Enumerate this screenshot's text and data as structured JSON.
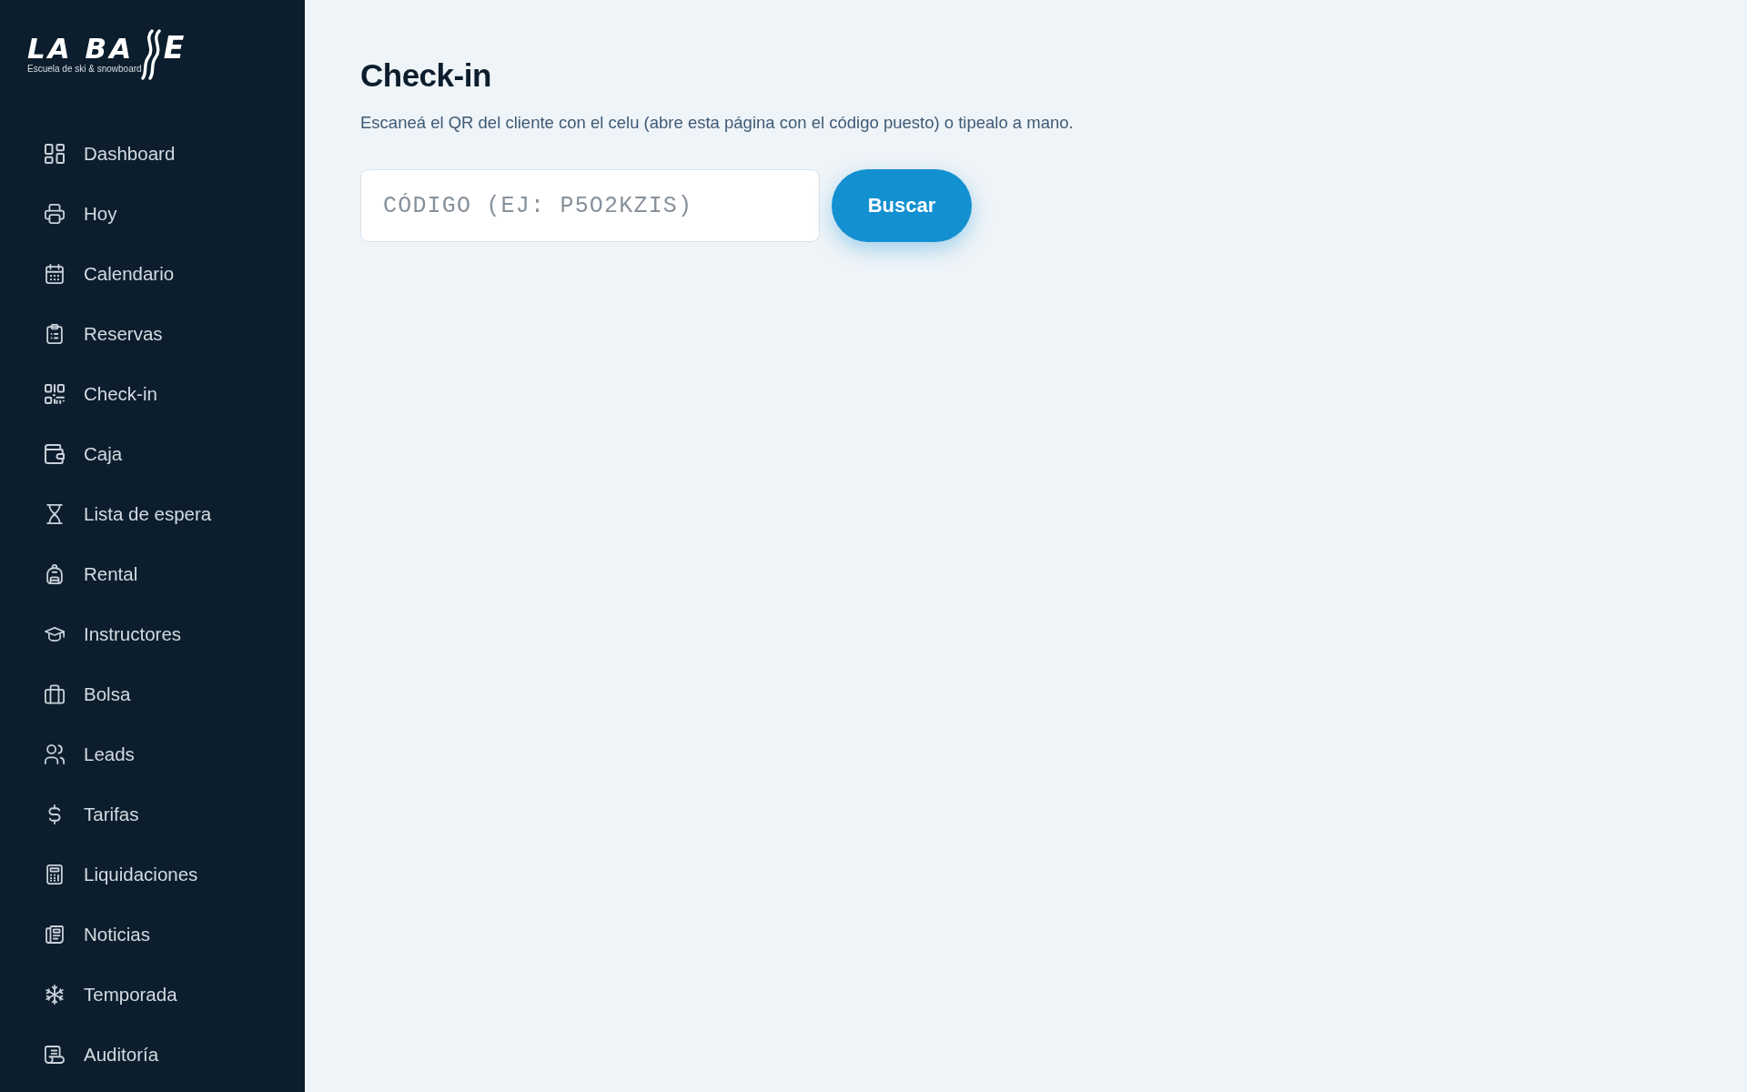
{
  "sidebar": {
    "logo": {
      "wordmark_start": "LA BA",
      "wordmark_end": "E",
      "tagline": "Escuela de ski & snowboard"
    },
    "items": [
      {
        "label": "Dashboard",
        "selected": false
      },
      {
        "label": "Hoy",
        "selected": false
      },
      {
        "label": "Calendario",
        "selected": false
      },
      {
        "label": "Reservas",
        "selected": false
      },
      {
        "label": "Check-in",
        "selected": false
      },
      {
        "label": "Caja",
        "selected": false
      },
      {
        "label": "Lista de espera",
        "selected": false
      },
      {
        "label": "Rental",
        "selected": false
      },
      {
        "label": "Instructores",
        "selected": false
      },
      {
        "label": "Bolsa",
        "selected": false
      },
      {
        "label": "Leads",
        "selected": false
      },
      {
        "label": "Tarifas",
        "selected": false
      },
      {
        "label": "Liquidaciones",
        "selected": false
      },
      {
        "label": "Noticias",
        "selected": false
      },
      {
        "label": "Temporada",
        "selected": false
      },
      {
        "label": "Auditoría",
        "selected": false
      }
    ]
  },
  "page": {
    "title": "Check-in",
    "description": "Escaneá el QR del cliente con el celu (abre esta página con el código puesto) o tipealo a mano.",
    "code_field": {
      "placeholder": "CÓDIGO (EJ: P5O2KZIS)"
    },
    "search_button": "Buscar"
  }
}
